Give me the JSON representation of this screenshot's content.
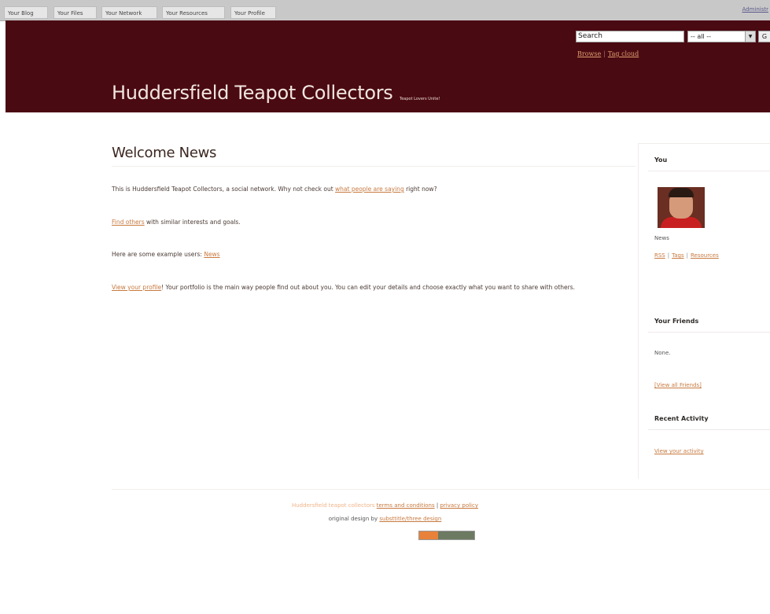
{
  "topbar": {
    "tabs": [
      "Your Blog",
      "Your Files",
      "Your Network",
      "Your Resources",
      "Your Profile"
    ],
    "admin_label": "Administr"
  },
  "header": {
    "search_placeholder": "Search",
    "search_scope": "-- all --",
    "go_label": "G",
    "links": [
      "Browse",
      "Tag cloud"
    ],
    "site_title": "Huddersfield Teapot Collectors",
    "tagline": "Teapot Lovers Unite!"
  },
  "main": {
    "title": "Welcome News",
    "p1_before": "This is Huddersfield Teapot Collectors, a social network. Why not check out ",
    "p1_link": "what people are saying",
    "p1_after": " right now?",
    "p2_link": "Find others",
    "p2_after": " with similar interests and goals.",
    "p3_before": "Here are some example users: ",
    "p3_link": "News",
    "p4_link": "View your profile",
    "p4_after": "! Your portfolio is the main way people find out about you. You can edit your details and choose exactly what you want to share with others."
  },
  "sidebar": {
    "you_heading": "You",
    "user_name": "News",
    "user_links": [
      "RSS",
      "Tags",
      "Resources"
    ],
    "friends_heading": "Your Friends",
    "friends_value": "None.",
    "view_friends_link": "[View all Friends]",
    "activity_heading": "Recent Activity",
    "activity_link": "View your activity"
  },
  "footer": {
    "line1_dim": "Huddersfield teapot collectors",
    "terms_link": "terms and conditions",
    "separator": "|",
    "privacy_link": "privacy policy",
    "line2_before": "original design by ",
    "designer_link": "substtitle/three design"
  }
}
